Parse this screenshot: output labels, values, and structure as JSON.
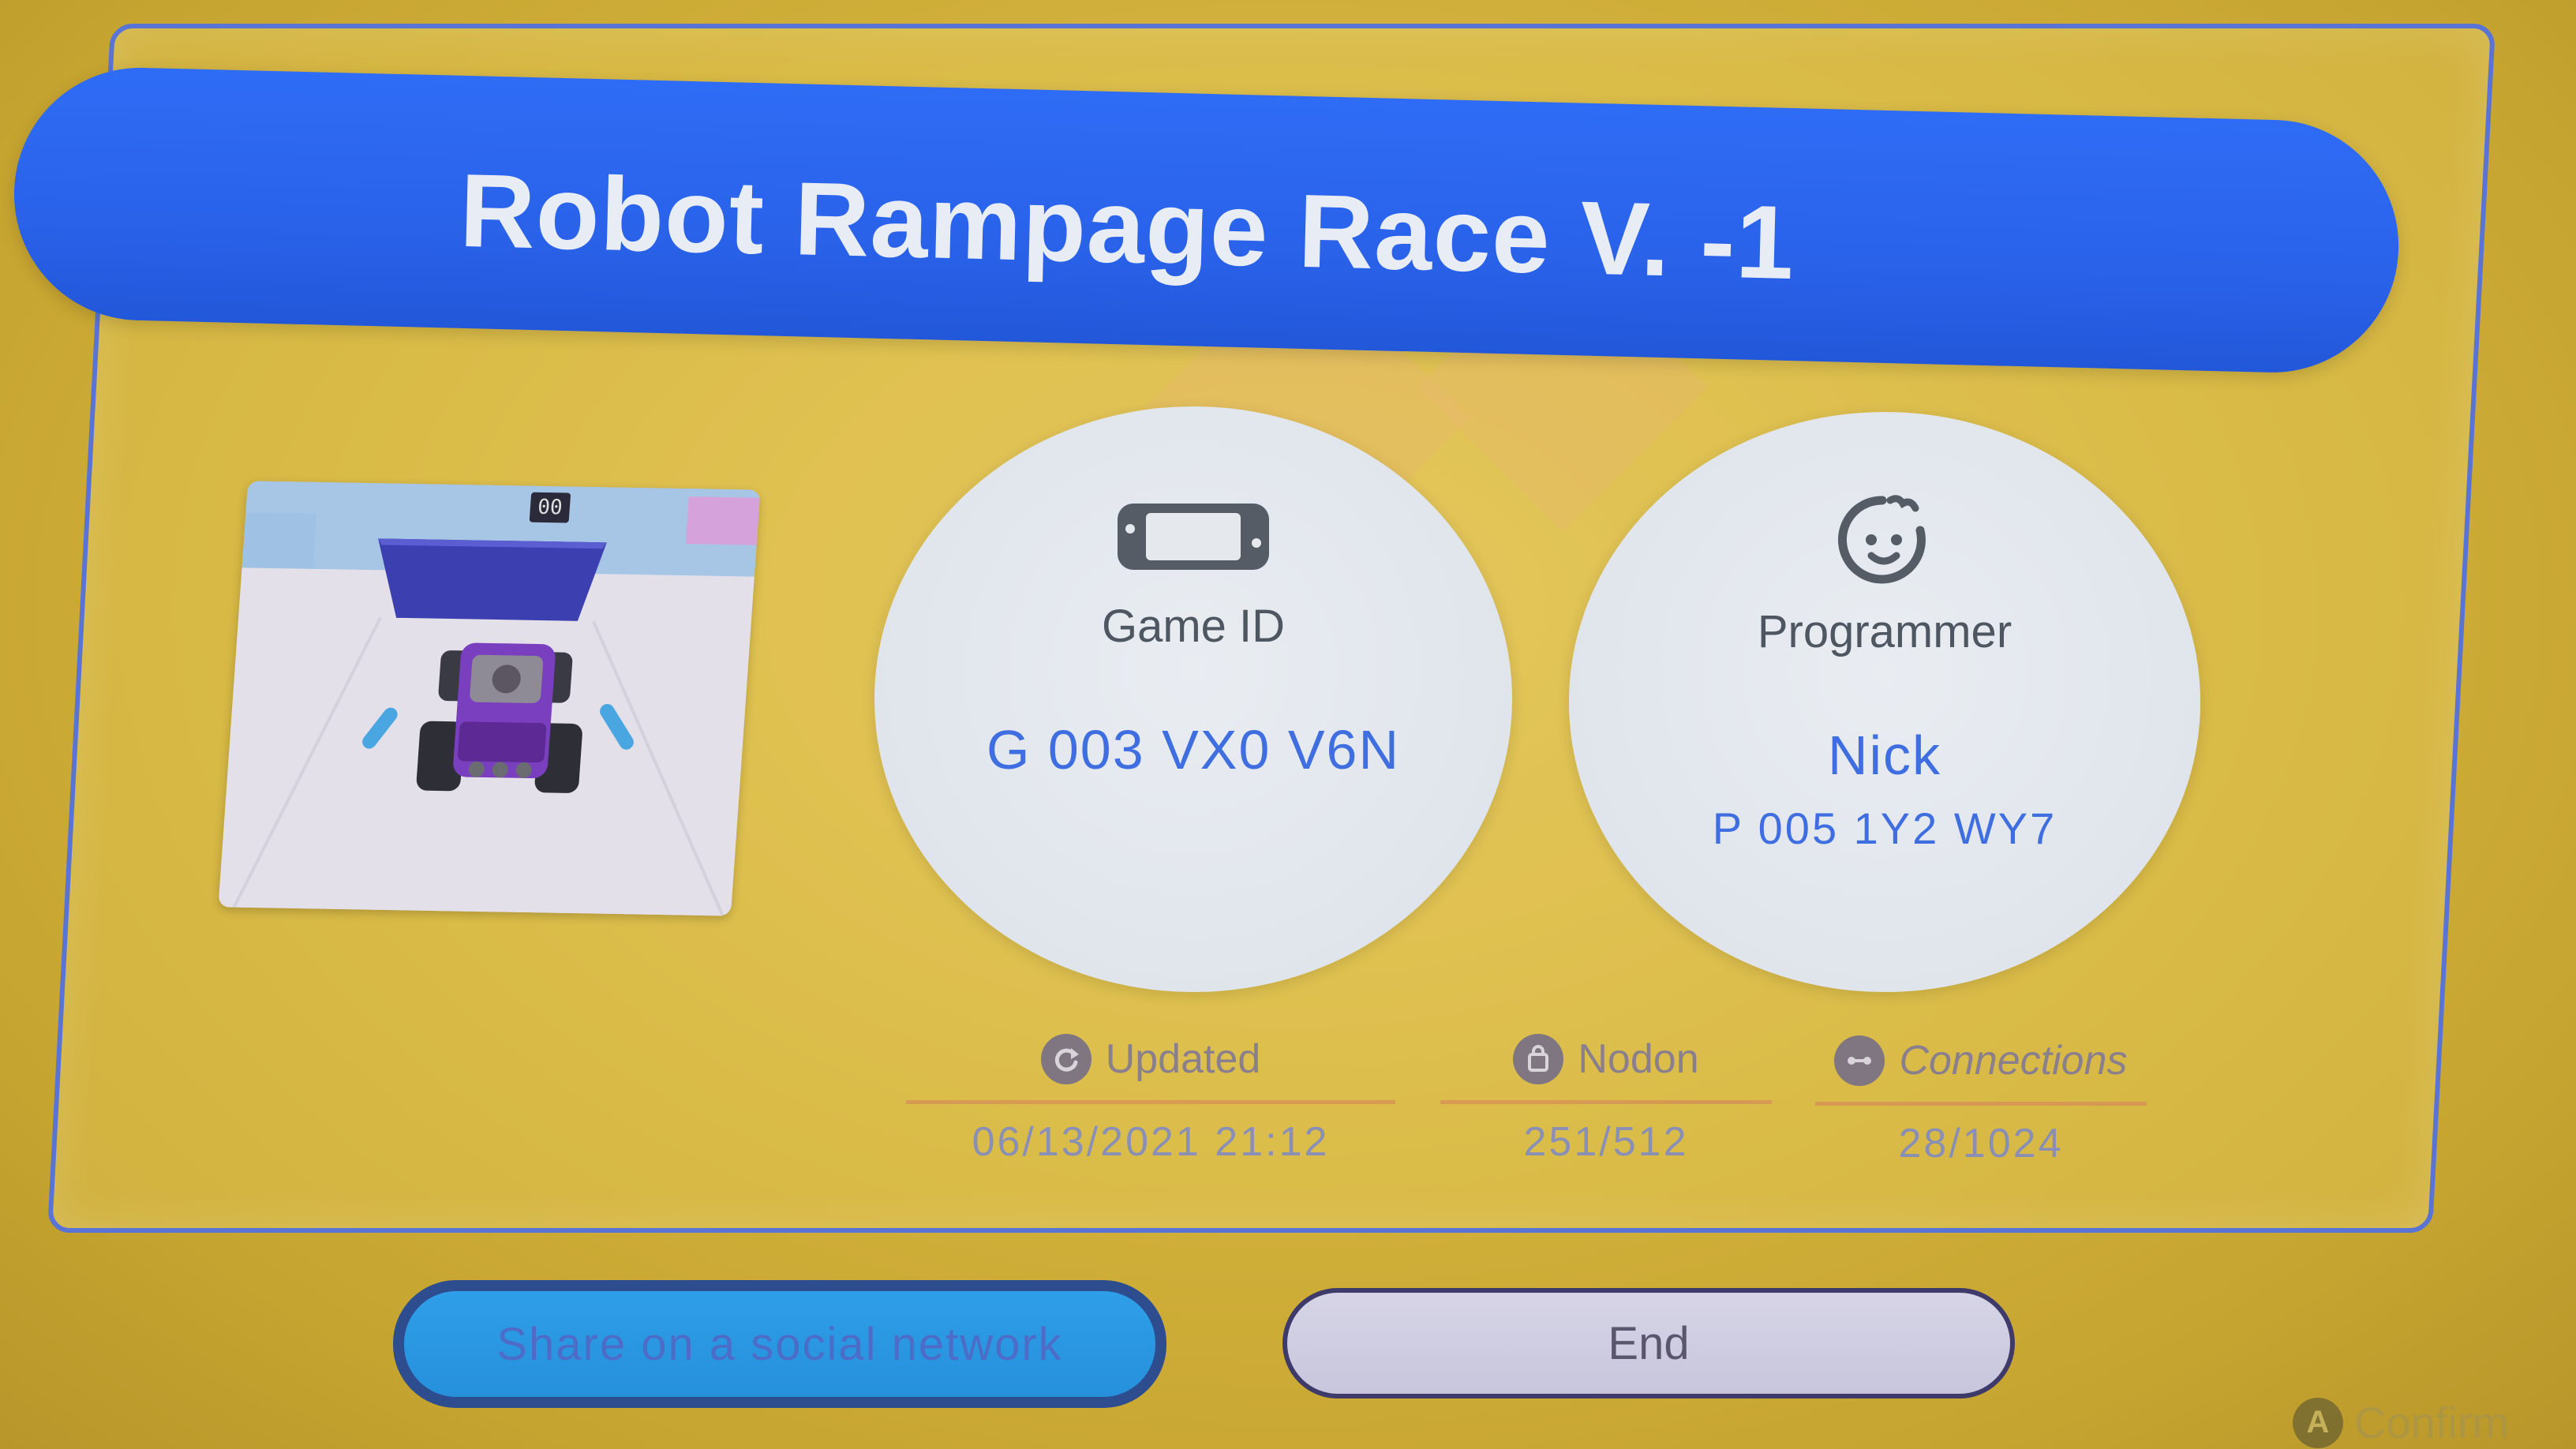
{
  "game": {
    "title": "Robot Rampage Race V. -1",
    "thumbnail_timer": "00"
  },
  "game_id": {
    "icon": "console-icon",
    "label": "Game ID",
    "value": "G 003 VX0 V6N"
  },
  "programmer": {
    "icon": "face-icon",
    "label": "Programmer",
    "name": "Nick",
    "id": "P 005 1Y2 WY7"
  },
  "stats": {
    "updated": {
      "icon": "refresh-icon",
      "label": "Updated",
      "value": "06/13/2021 21:12"
    },
    "nodon": {
      "icon": "bag-icon",
      "label": "Nodon",
      "value": "251/512"
    },
    "connections": {
      "icon": "link-icon",
      "label": "Connections",
      "value": "28/1024"
    }
  },
  "buttons": {
    "share_label": "Share on a social network",
    "end_label": "End"
  },
  "hint": {
    "button": "A",
    "label": "Confirm"
  },
  "colors": {
    "background": "#d4b442",
    "title_bar": "#2a62ea",
    "accent_text": "#3f6ee0",
    "share_button": "#2b96e2",
    "end_button": "#d0cee2"
  }
}
